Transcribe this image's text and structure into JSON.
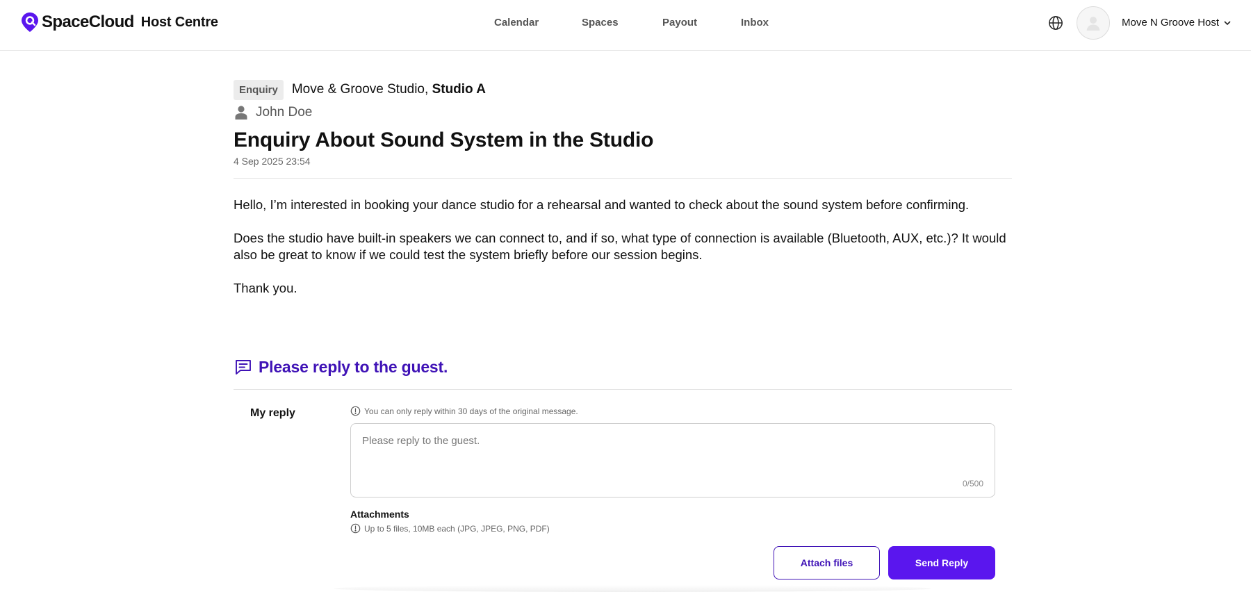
{
  "header": {
    "brand_name": "SpaceCloud",
    "brand_sub": "Host Centre",
    "nav": [
      {
        "label": "Calendar"
      },
      {
        "label": "Spaces"
      },
      {
        "label": "Payout"
      },
      {
        "label": "Inbox"
      }
    ],
    "user_name": "Move N Groove Host"
  },
  "enquiry": {
    "tag": "Enquiry",
    "venue": "Move & Groove Studio,",
    "room": "Studio A",
    "guest_name": "John Doe",
    "title": "Enquiry About Sound System in the Studio",
    "date": "4 Sep 2025 23:54",
    "message": [
      "Hello, I’m interested in booking your dance studio for a rehearsal and wanted to check about the sound system before confirming.",
      "Does the studio have built-in speakers we can connect to, and if so, what type of connection is available (Bluetooth, AUX, etc.)? It would also be great to know if we could test the system briefly before our session begins.",
      "Thank you."
    ]
  },
  "reply": {
    "heading": "Please reply to the guest.",
    "label": "My reply",
    "note": "You can only reply within 30 days of the original message.",
    "placeholder": "Please reply to the guest.",
    "value": "",
    "counter": "0/500",
    "attachments_label": "Attachments",
    "attachments_note": "Up to 5 files, 10MB each (JPG, JPEG, PNG, PDF)",
    "attach_button": "Attach files",
    "send_button": "Send Reply"
  },
  "colors": {
    "accent": "#3f12b6",
    "primary_button": "#5a16ee",
    "logo": "#5a16ee"
  },
  "icons": {
    "logo": "spacecloud-pin-logo",
    "globe": "globe-icon",
    "avatar": "user-avatar-icon",
    "chevron": "chevron-down-icon",
    "guest": "person-icon",
    "reply_heading": "message-icon",
    "info": "info-icon"
  }
}
